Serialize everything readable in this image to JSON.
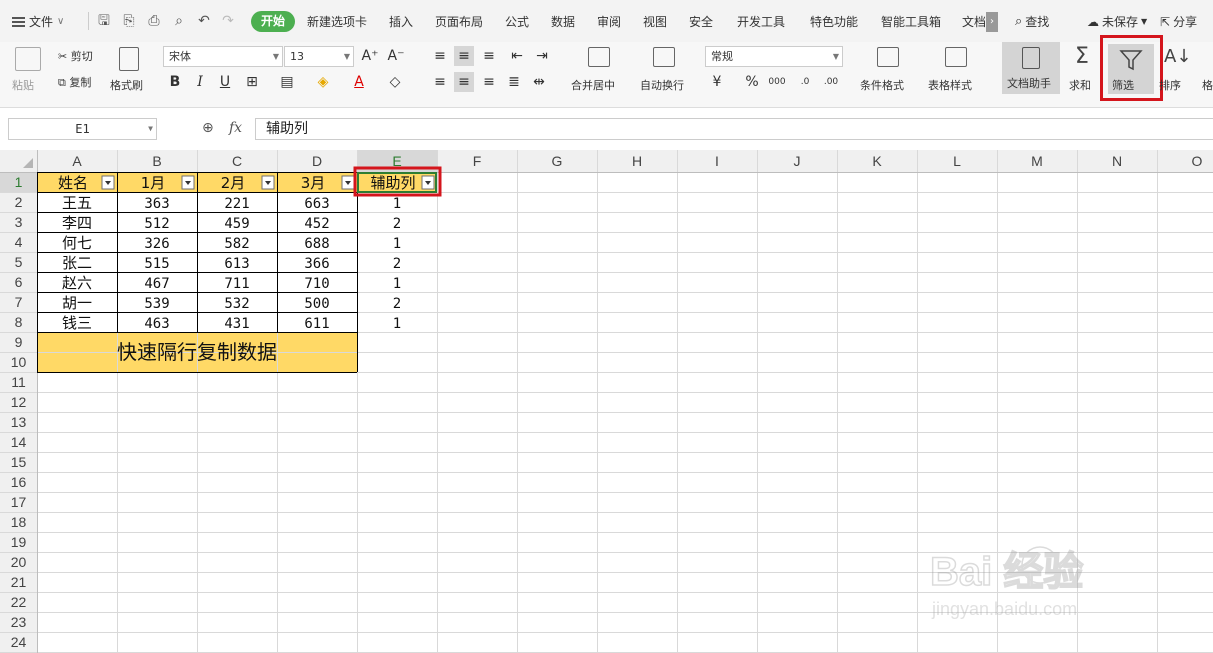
{
  "menu": {
    "file_label": "文件",
    "tabs": [
      "开始",
      "新建选项卡",
      "插入",
      "页面布局",
      "公式",
      "数据",
      "审阅",
      "视图",
      "安全",
      "开发工具",
      "特色功能",
      "智能工具箱",
      "文档"
    ],
    "active_tab": "开始",
    "search_label": "查找",
    "save_status": "未保存",
    "share_label": "分享"
  },
  "ribbon": {
    "paste": "粘贴",
    "cut": "剪切",
    "copy": "复制",
    "format_painter": "格式刷",
    "font_name": "宋体",
    "font_size": "13",
    "merge_center": "合并居中",
    "wrap_text": "自动换行",
    "number_format": "常规",
    "conditional_format": "条件格式",
    "table_style": "表格样式",
    "doc_helper": "文档助手",
    "sum": "求和",
    "filter": "筛选",
    "sort": "排序",
    "fill": "格"
  },
  "formula_bar": {
    "cell_ref": "E1",
    "fx": "fx",
    "content": "辅助列"
  },
  "sheet": {
    "columns": [
      "A",
      "B",
      "C",
      "D",
      "E",
      "F",
      "G",
      "H",
      "I",
      "J",
      "K",
      "L",
      "M",
      "N",
      "O"
    ],
    "row_count": 24,
    "header": [
      "姓名",
      "1月",
      "2月",
      "3月",
      "辅助列"
    ],
    "rows": [
      [
        "王五",
        "363",
        "221",
        "663",
        "1"
      ],
      [
        "李四",
        "512",
        "459",
        "452",
        "2"
      ],
      [
        "何七",
        "326",
        "582",
        "688",
        "1"
      ],
      [
        "张二",
        "515",
        "613",
        "366",
        "2"
      ],
      [
        "赵六",
        "467",
        "711",
        "710",
        "1"
      ],
      [
        "胡一",
        "539",
        "532",
        "500",
        "2"
      ],
      [
        "钱三",
        "463",
        "431",
        "611",
        "1"
      ]
    ],
    "merged_title": "快速隔行复制数据",
    "header_fill": "#ffd966",
    "title_fill": "#ffd966",
    "accent_green": "#4caf50",
    "highlight_red": "#d4151c"
  },
  "watermark": {
    "brand": "Bai  经验",
    "url": "jingyan.baidu.com"
  }
}
